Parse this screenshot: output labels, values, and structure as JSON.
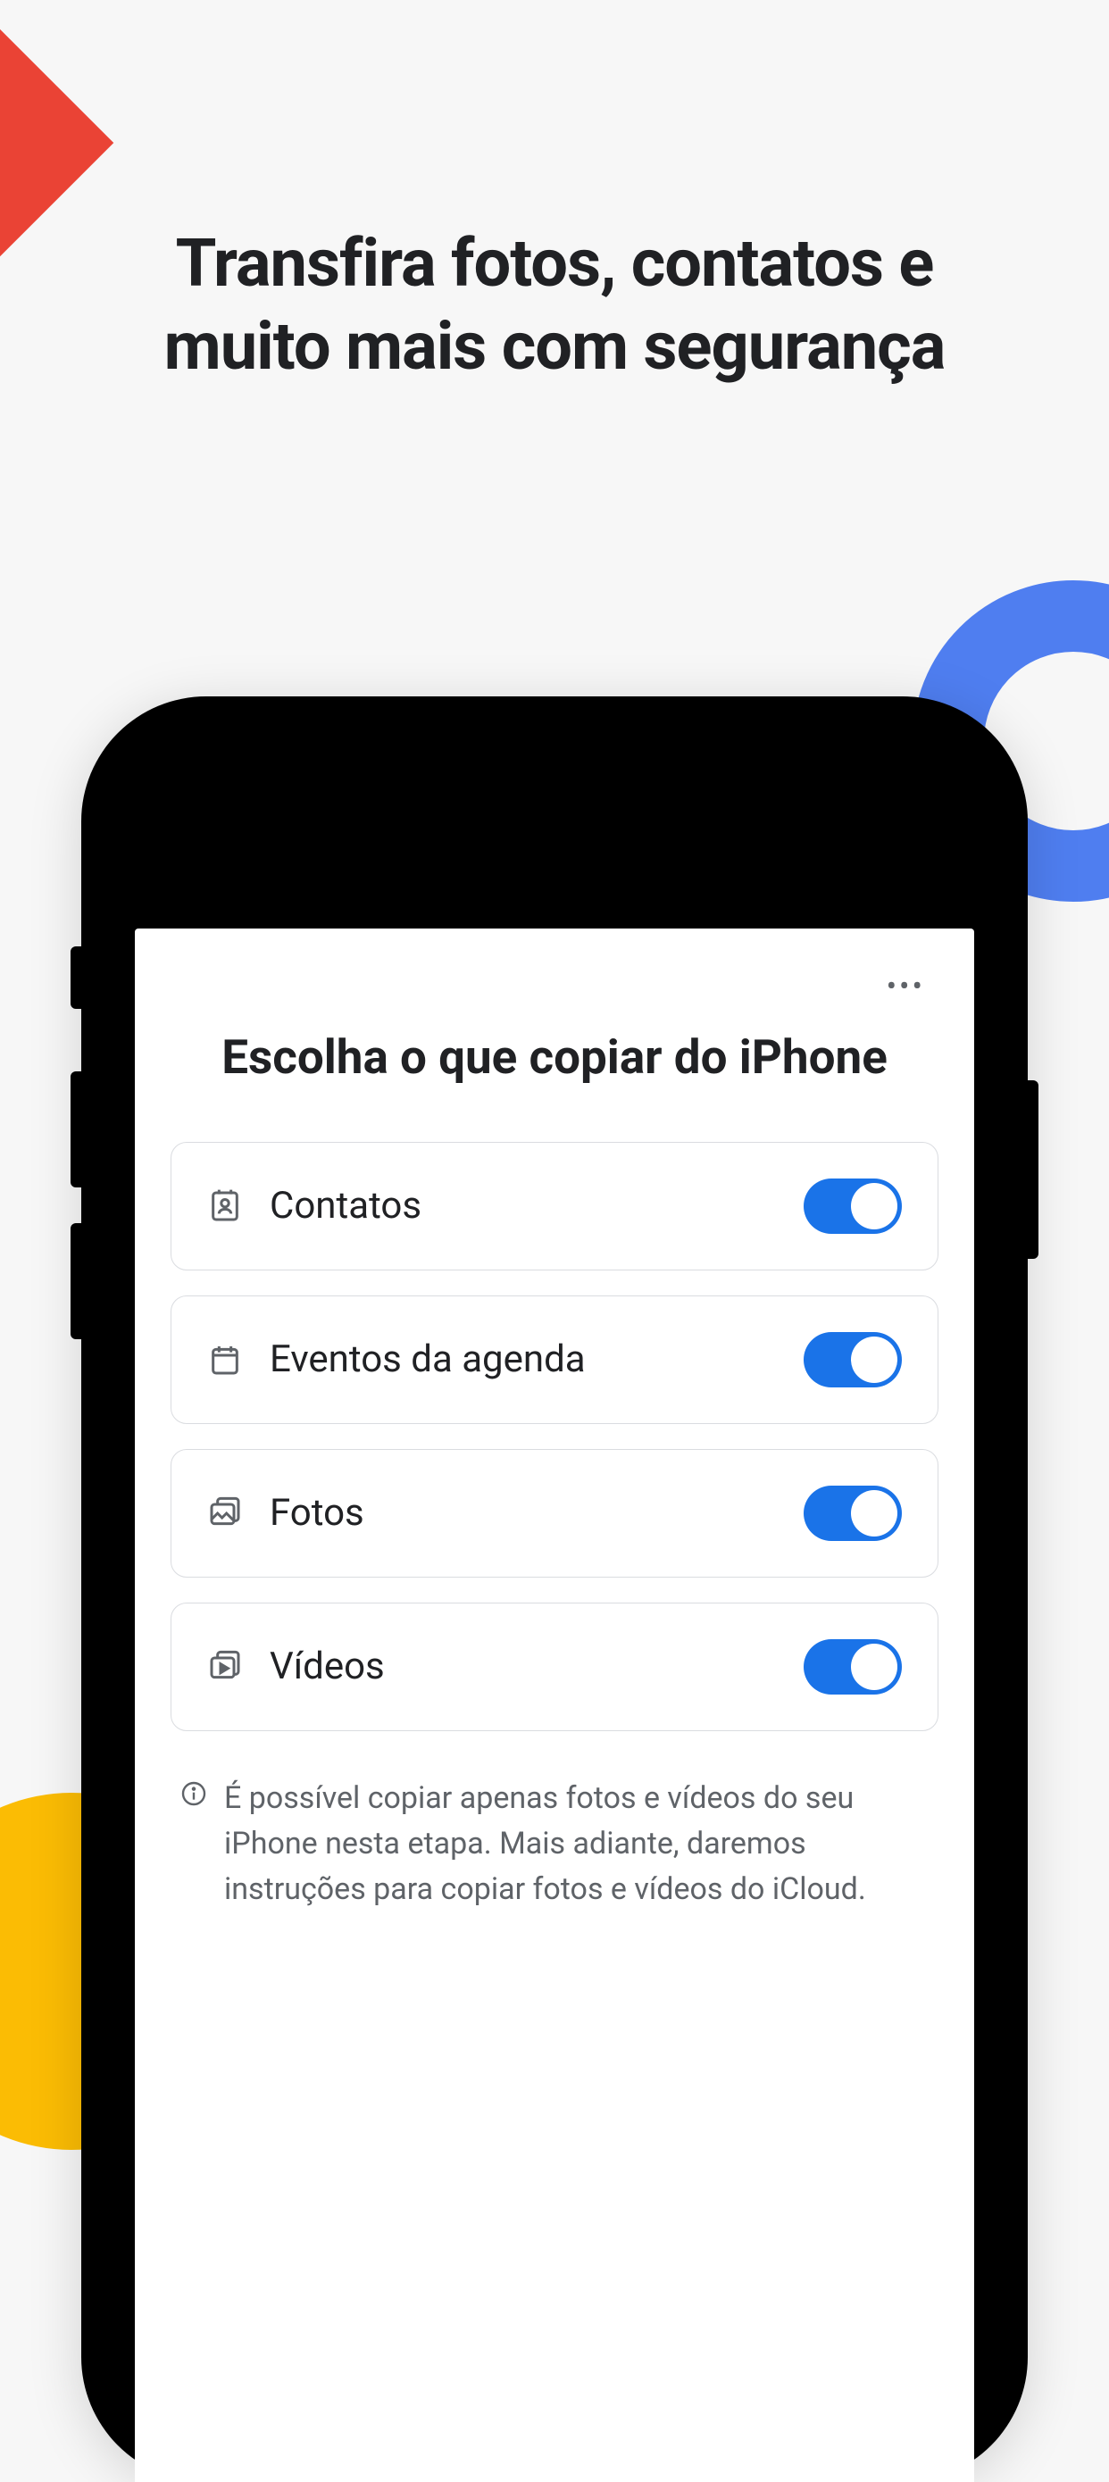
{
  "headline": "Transfira fotos, contatos e muito mais com segurança",
  "screen": {
    "title": "Escolha o que copiar do iPhone",
    "items": [
      {
        "label": "Contatos",
        "icon": "contacts-icon",
        "on": true
      },
      {
        "label": "Eventos da agenda",
        "icon": "calendar-icon",
        "on": true
      },
      {
        "label": "Fotos",
        "icon": "photos-icon",
        "on": true
      },
      {
        "label": "Vídeos",
        "icon": "videos-icon",
        "on": true
      }
    ],
    "info": "É possível copiar apenas fotos e vídeos do seu iPhone nesta etapa. Mais adiante, daremos instruções para copiar fotos e vídeos do iCloud."
  }
}
